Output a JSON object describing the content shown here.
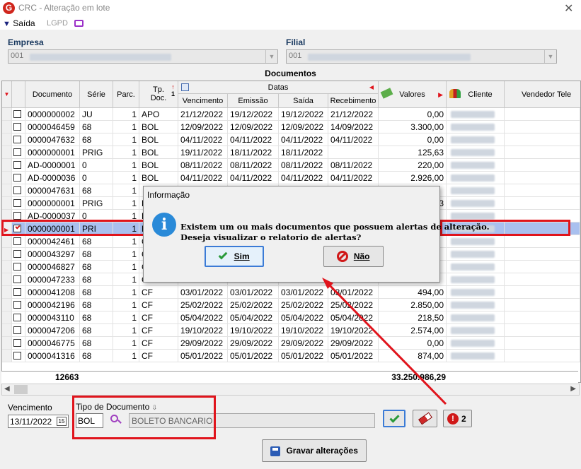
{
  "window": {
    "title": "CRC - Alteração em lote",
    "logo_letter": "G",
    "close": "✕"
  },
  "menu": {
    "saida": "Saída",
    "lgpd": "LGPD"
  },
  "empresa": {
    "label": "Empresa",
    "value": "001"
  },
  "filial": {
    "label": "Filial",
    "value": "001"
  },
  "documentos_title": "Documentos",
  "columns": {
    "documento": "Documento",
    "serie": "Série",
    "parc": "Parc.",
    "tpdoc": "Tp. Doc.",
    "tpdoc_sort": "1",
    "datas": "Datas",
    "vencimento": "Vencimento",
    "emissao": "Emissão",
    "saida": "Saída",
    "recebimento": "Recebimento",
    "valores": "Valores",
    "cliente": "Cliente",
    "vendedor": "Vendedor Tele"
  },
  "rows": [
    {
      "doc": "0000000002",
      "serie": "JU",
      "parc": "1",
      "tp": "APO",
      "venc": "21/12/2022",
      "emis": "19/12/2022",
      "saida": "19/12/2022",
      "receb": "21/12/2022",
      "valor": "0,00",
      "checked": false
    },
    {
      "doc": "0000046459",
      "serie": "68",
      "parc": "1",
      "tp": "BOL",
      "venc": "12/09/2022",
      "emis": "12/09/2022",
      "saida": "12/09/2022",
      "receb": "14/09/2022",
      "valor": "3.300,00",
      "checked": false
    },
    {
      "doc": "0000047632",
      "serie": "68",
      "parc": "1",
      "tp": "BOL",
      "venc": "04/11/2022",
      "emis": "04/11/2022",
      "saida": "04/11/2022",
      "receb": "04/11/2022",
      "valor": "0,00",
      "checked": false
    },
    {
      "doc": "0000000001",
      "serie": "PRIG",
      "parc": "1",
      "tp": "BOL",
      "venc": "19/11/2022",
      "emis": "18/11/2022",
      "saida": "18/11/2022",
      "receb": "",
      "valor": "125,63",
      "checked": false
    },
    {
      "doc": "AD-0000001",
      "serie": "0",
      "parc": "1",
      "tp": "BOL",
      "venc": "08/11/2022",
      "emis": "08/11/2022",
      "saida": "08/11/2022",
      "receb": "08/11/2022",
      "valor": "220,00",
      "checked": false
    },
    {
      "doc": "AD-0000036",
      "serie": "0",
      "parc": "1",
      "tp": "BOL",
      "venc": "04/11/2022",
      "emis": "04/11/2022",
      "saida": "04/11/2022",
      "receb": "04/11/2022",
      "valor": "2.926,00",
      "checked": false
    },
    {
      "doc": "0000047631",
      "serie": "68",
      "parc": "1",
      "tp": "",
      "venc": "",
      "emis": "",
      "saida": "",
      "receb": "",
      "valor": "",
      "checked": false
    },
    {
      "doc": "0000000001",
      "serie": "PRIG",
      "parc": "1",
      "tp": "B",
      "venc": "",
      "emis": "",
      "saida": "",
      "receb": "",
      "valor": "63",
      "checked": false
    },
    {
      "doc": "AD-0000037",
      "serie": "0",
      "parc": "1",
      "tp": "B",
      "venc": "",
      "emis": "",
      "saida": "",
      "receb": "",
      "valor": "",
      "checked": false
    },
    {
      "doc": "0000000001",
      "serie": "PRI",
      "parc": "1",
      "tp": "B",
      "venc": "",
      "emis": "",
      "saida": "",
      "receb": "",
      "valor": "",
      "checked": true
    },
    {
      "doc": "0000042461",
      "serie": "68",
      "parc": "1",
      "tp": "C",
      "venc": "",
      "emis": "",
      "saida": "",
      "receb": "",
      "valor": "",
      "checked": false
    },
    {
      "doc": "0000043297",
      "serie": "68",
      "parc": "1",
      "tp": "C",
      "venc": "",
      "emis": "",
      "saida": "",
      "receb": "",
      "valor": "",
      "checked": false
    },
    {
      "doc": "0000046827",
      "serie": "68",
      "parc": "1",
      "tp": "C",
      "venc": "",
      "emis": "",
      "saida": "",
      "receb": "",
      "valor": "",
      "checked": false
    },
    {
      "doc": "0000047233",
      "serie": "68",
      "parc": "1",
      "tp": "C",
      "venc": "",
      "emis": "",
      "saida": "",
      "receb": "",
      "valor": "",
      "checked": false
    },
    {
      "doc": "0000041208",
      "serie": "68",
      "parc": "1",
      "tp": "CF",
      "venc": "03/01/2022",
      "emis": "03/01/2022",
      "saida": "03/01/2022",
      "receb": "03/01/2022",
      "valor": "494,00",
      "checked": false
    },
    {
      "doc": "0000042196",
      "serie": "68",
      "parc": "1",
      "tp": "CF",
      "venc": "25/02/2022",
      "emis": "25/02/2022",
      "saida": "25/02/2022",
      "receb": "25/02/2022",
      "valor": "2.850,00",
      "checked": false
    },
    {
      "doc": "0000043110",
      "serie": "68",
      "parc": "1",
      "tp": "CF",
      "venc": "05/04/2022",
      "emis": "05/04/2022",
      "saida": "05/04/2022",
      "receb": "05/04/2022",
      "valor": "218,50",
      "checked": false
    },
    {
      "doc": "0000047206",
      "serie": "68",
      "parc": "1",
      "tp": "CF",
      "venc": "19/10/2022",
      "emis": "19/10/2022",
      "saida": "19/10/2022",
      "receb": "19/10/2022",
      "valor": "2.574,00",
      "checked": false
    },
    {
      "doc": "0000046775",
      "serie": "68",
      "parc": "1",
      "tp": "CF",
      "venc": "29/09/2022",
      "emis": "29/09/2022",
      "saida": "29/09/2022",
      "receb": "29/09/2022",
      "valor": "0,00",
      "checked": false
    },
    {
      "doc": "0000041316",
      "serie": "68",
      "parc": "1",
      "tp": "CF",
      "venc": "05/01/2022",
      "emis": "05/01/2022",
      "saida": "05/01/2022",
      "receb": "05/01/2022",
      "valor": "874,00",
      "checked": false
    }
  ],
  "totals": {
    "count": "12663",
    "valor": "33.250.986,29"
  },
  "footer": {
    "vencimento_label": "Vencimento",
    "vencimento_value": "13/11/2022",
    "calendar": "15",
    "tipo_label": "Tipo de Documento",
    "tipo_code": "BOL",
    "tipo_desc": "BOLETO BANCARIO",
    "alert_count": "2",
    "gravar": "Gravar alterações",
    "alert_glyph": "!"
  },
  "dialog": {
    "title": "Informação",
    "icon_glyph": "i",
    "msg1": "Existem um ou mais documentos que possuem alertas de alteração.",
    "msg2": "Deseja visualizar o relatorio de alertas?",
    "sim": "Sim",
    "nao": "Não"
  },
  "colors": {
    "accent_red": "#e0141c",
    "selection": "#a9c0ef",
    "info_blue": "#2a8ad8"
  },
  "icons": [
    "app-logo",
    "close-icon",
    "exit-arrow-icon",
    "monitor-icon",
    "sort-icon",
    "calendar-icon",
    "money-icon",
    "people-icon",
    "search-icon",
    "check-icon",
    "eraser-icon",
    "alert-icon",
    "save-icon",
    "info-icon",
    "no-icon"
  ]
}
